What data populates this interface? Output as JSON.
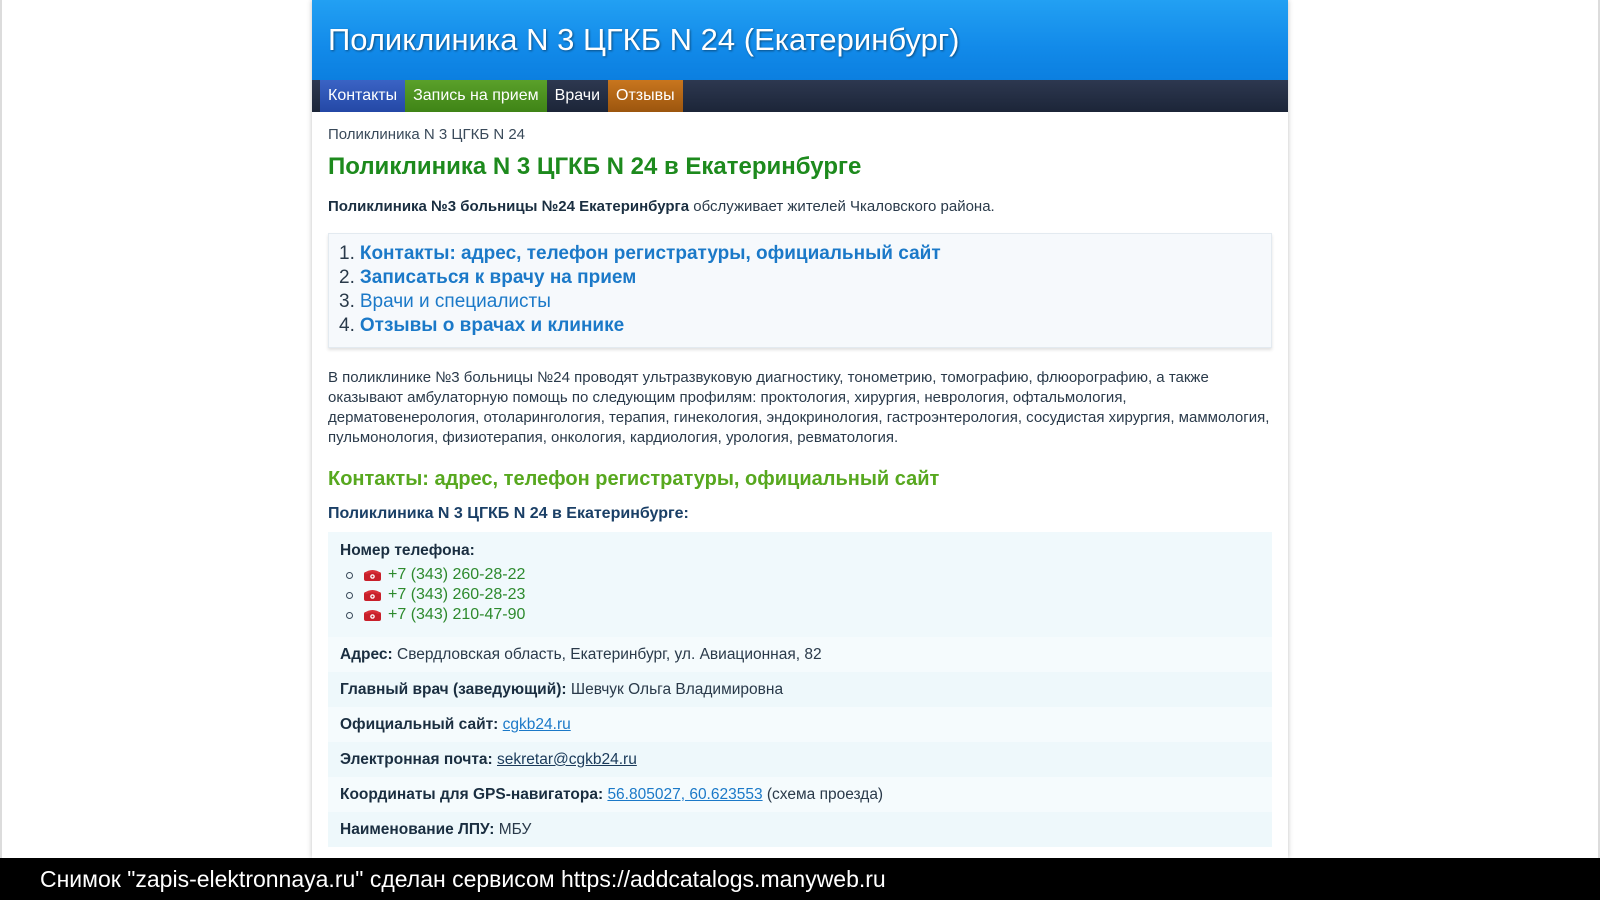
{
  "header": {
    "title": "Поликлиника N 3 ЦГКБ N 24 (Екатеринбург)"
  },
  "nav": [
    {
      "label": "Контакты"
    },
    {
      "label": "Запись на прием"
    },
    {
      "label": "Врачи"
    },
    {
      "label": "Отзывы"
    }
  ],
  "breadcrumb": "Поликлиника N 3 ЦГКБ N 24",
  "main_title": "Поликлиника N 3 ЦГКБ N 24 в Екатеринбурге",
  "intro": {
    "bold": "Поликлиника №3 больницы №24 Екатеринбурга",
    "rest": " обслуживает жителей Чкаловского района."
  },
  "toc": [
    {
      "num": "1.",
      "label": "Контакты: адрес, телефон регистратуры, официальный сайт"
    },
    {
      "num": "2.",
      "label": "Записаться к врачу на прием"
    },
    {
      "num": "3.",
      "label": "Врачи и специалисты"
    },
    {
      "num": "4.",
      "label": "Отзывы о врачах и клинике"
    }
  ],
  "description": "В поликлинике №3 больницы №24 проводят ультразвуковую диагностику, тонометрию, томографию, флюорографию, а также оказывают амбулаторную помощь по следующим профилям: проктология, хирургия, неврология, офтальмология, дерматовенерология, отоларингология, терапия, гинекология, эндокринология, гастроэнтерология, сосудистая хирургия, маммология, пульмонология, физиотерапия, онкология, кардиология, урология, ревматология.",
  "contacts": {
    "heading": "Контакты: адрес, телефон регистратуры, официальный сайт",
    "subheading": "Поликлиника N 3 ЦГКБ N 24 в Екатеринбурге:",
    "phone_label": "Номер телефона:",
    "phones": [
      "+7 (343) 260-28-22",
      "+7 (343) 260-28-23",
      "+7 (343) 210-47-90"
    ],
    "address_label": "Адрес:",
    "address": " Свердловская область, Екатеринбург, ул. Авиационная, 82",
    "chief_label": "Главный врач (заведующий):",
    "chief": " Шевчук Ольга Владимировна",
    "site_label": "Официальный сайт:",
    "site": "cgkb24.ru",
    "email_label": "Электронная почта:",
    "email": "sekretar@cgkb24.ru",
    "gps_label": "Координаты для GPS-навигатора:",
    "gps": "56.805027, 60.623553",
    "gps_note": " (схема проезда)",
    "lpu_label": "Наименование ЛПУ:",
    "lpu": " МБУ"
  },
  "watermark": "Снимок \"zapis-elektronnaya.ru\" сделан сервисом https://addcatalogs.manyweb.ru",
  "colors": {
    "header_blue": "#128ae9",
    "title_green": "#1d8a1d",
    "section_green": "#57a81f",
    "link_blue": "#1b79c8",
    "phone_green": "#2d8a2d"
  },
  "icons": {
    "phone": "phone-icon"
  }
}
